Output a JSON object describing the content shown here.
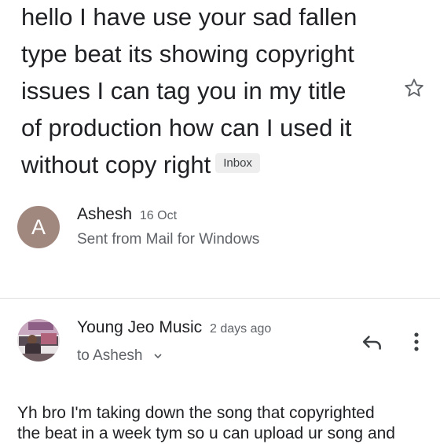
{
  "thread": {
    "subject_lines": [
      "hello I have use your sad fallen",
      "type beat its showing copyright",
      "issues I can tag you in my title",
      "of production how can I used it",
      "without copy right"
    ],
    "label_chip": "Inbox"
  },
  "messages": [
    {
      "avatar_letter": "A",
      "avatar_color": "#a1887f",
      "sender": "Ashesh",
      "date": "16 Oct",
      "snippet": "Sent from Mail for Windows"
    },
    {
      "sender": "Young Jeo Music",
      "date": "2 days ago",
      "to_text": "to Ashesh",
      "body_lines": [
        "Yh bro I'm taking down the song that copyrighted",
        "the beat in a week tym so u can upload ur song and"
      ]
    }
  ],
  "icons": {
    "star": "star-outline-icon",
    "reply": "reply-icon",
    "more": "more-vert-icon",
    "chevron": "chevron-down-icon"
  }
}
